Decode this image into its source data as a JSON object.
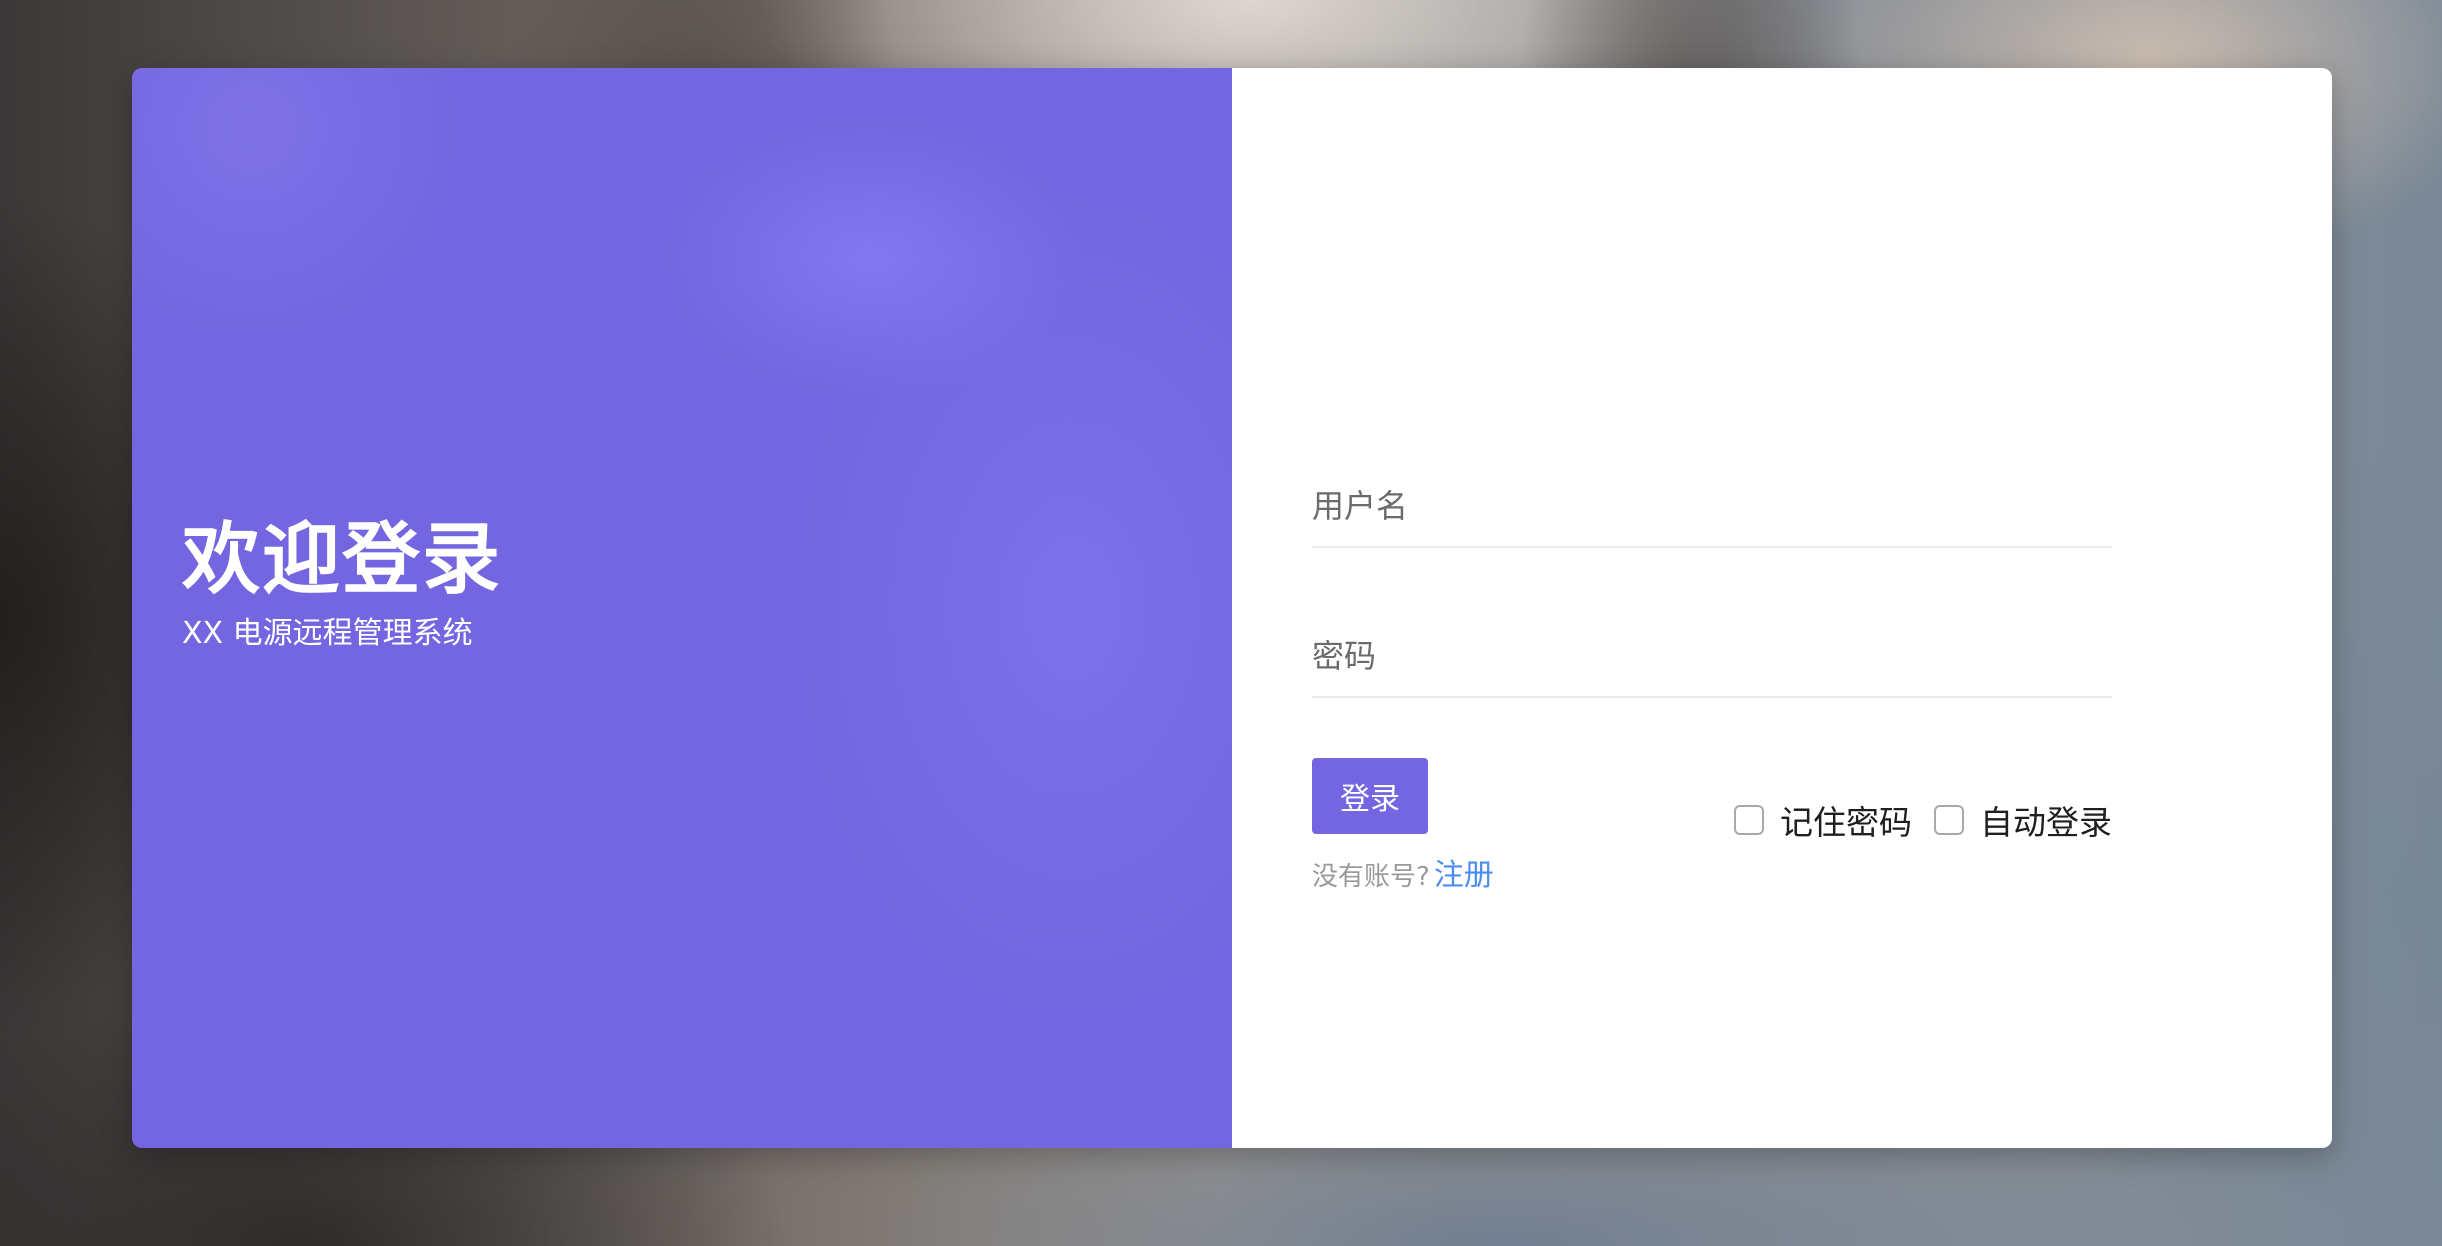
{
  "welcome": {
    "title": "欢迎登录",
    "subtitle": "XX 电源远程管理系统"
  },
  "form": {
    "username_placeholder": "用户名",
    "username_value": "",
    "password_placeholder": "密码",
    "password_value": "",
    "login_label": "登录",
    "no_account_text": "没有账号?",
    "register_label": "注册",
    "remember_label": "记住密码",
    "remember_checked": false,
    "auto_login_label": "自动登录",
    "auto_login_checked": false
  },
  "colors": {
    "accent": "#7366e0",
    "link": "#4a8ef0"
  }
}
